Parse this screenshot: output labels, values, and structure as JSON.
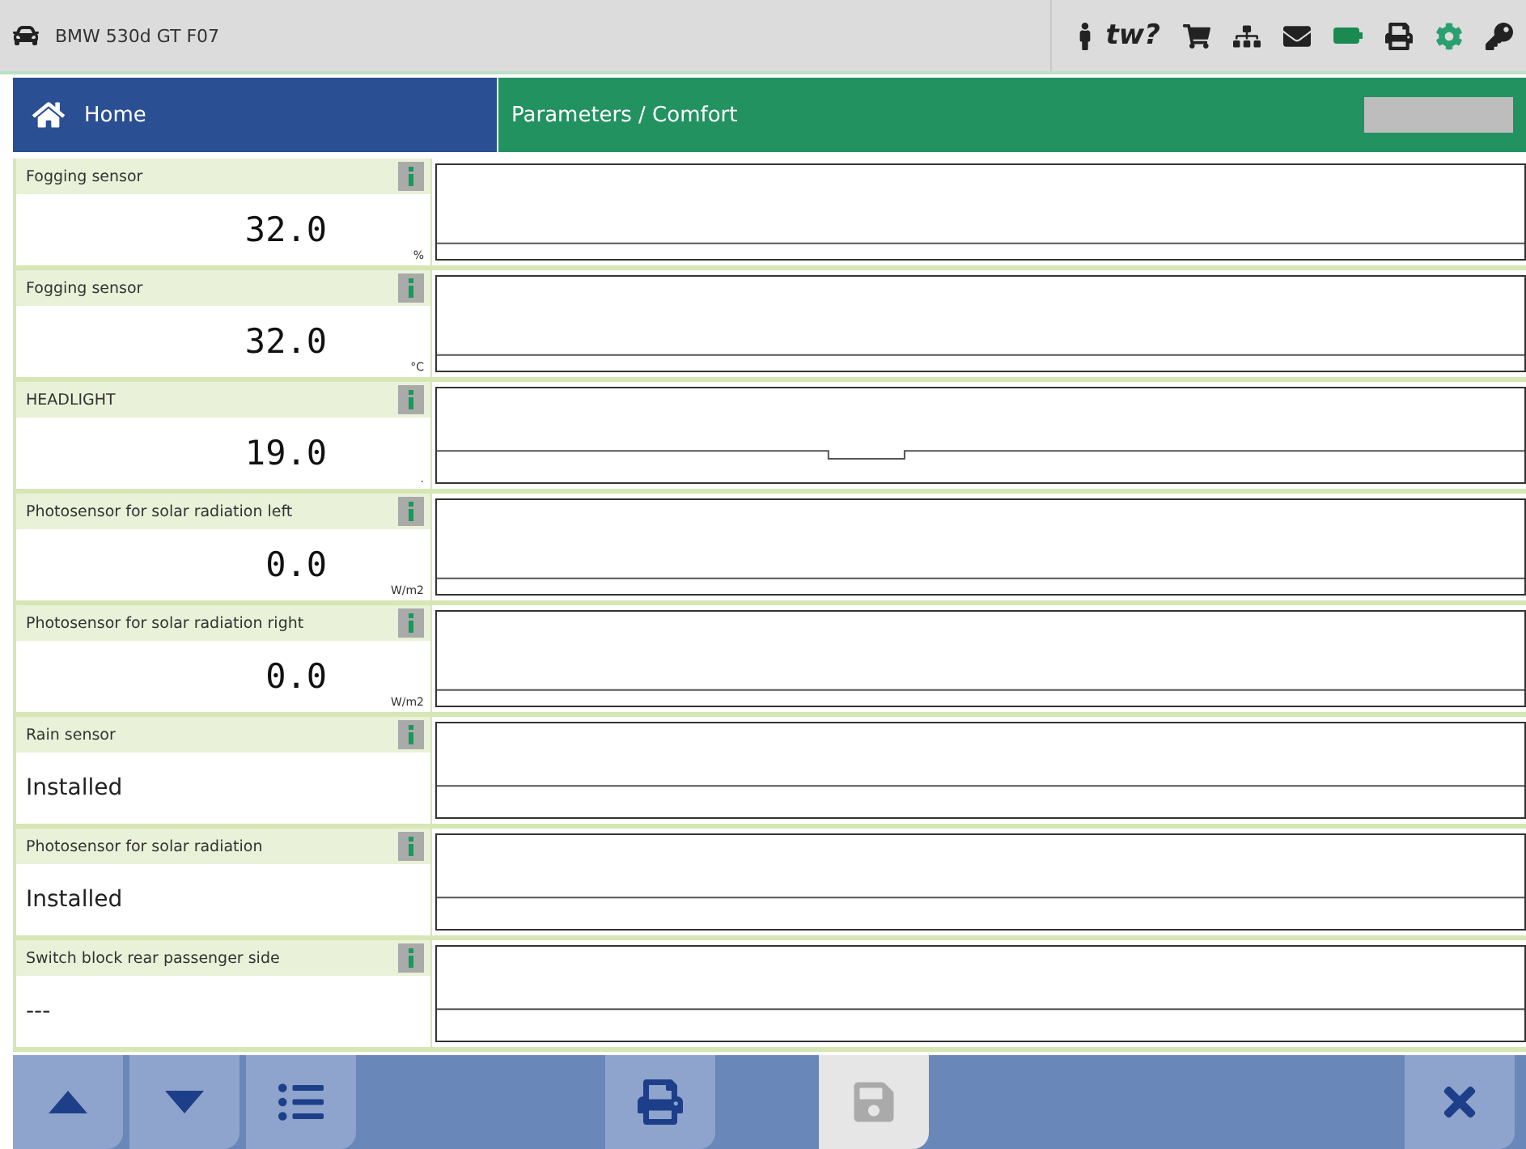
{
  "header": {
    "vehicle": "BMW 530d GT F07",
    "help_text": "tw?"
  },
  "nav": {
    "home": "Home",
    "breadcrumb": "Parameters / Comfort"
  },
  "parameters": [
    {
      "kind": "numeric",
      "label": "Fogging sensor",
      "value": "32.0",
      "unit": "%"
    },
    {
      "kind": "numeric",
      "label": "Fogging sensor",
      "value": "32.0",
      "unit": "°C"
    },
    {
      "kind": "numeric",
      "label": "HEADLIGHT",
      "value": "19.0",
      "unit": "."
    },
    {
      "kind": "numeric",
      "label": "Photosensor for solar radiation left",
      "value": "0.0",
      "unit": "W/m2"
    },
    {
      "kind": "numeric",
      "label": "Photosensor for solar radiation right",
      "value": "0.0",
      "unit": "W/m2"
    },
    {
      "kind": "status",
      "label": "Rain sensor",
      "value": "Installed"
    },
    {
      "kind": "status",
      "label": "Photosensor for solar radiation",
      "value": "Installed"
    },
    {
      "kind": "status",
      "label": "Switch block rear passenger side",
      "value": "---"
    }
  ],
  "toolbar": [
    {
      "kind": "up",
      "disabled": false
    },
    {
      "kind": "down",
      "disabled": false
    },
    {
      "kind": "list",
      "disabled": false
    },
    {
      "kind": "print",
      "disabled": false
    },
    {
      "kind": "save",
      "disabled": true
    },
    {
      "kind": "close",
      "disabled": false
    }
  ]
}
